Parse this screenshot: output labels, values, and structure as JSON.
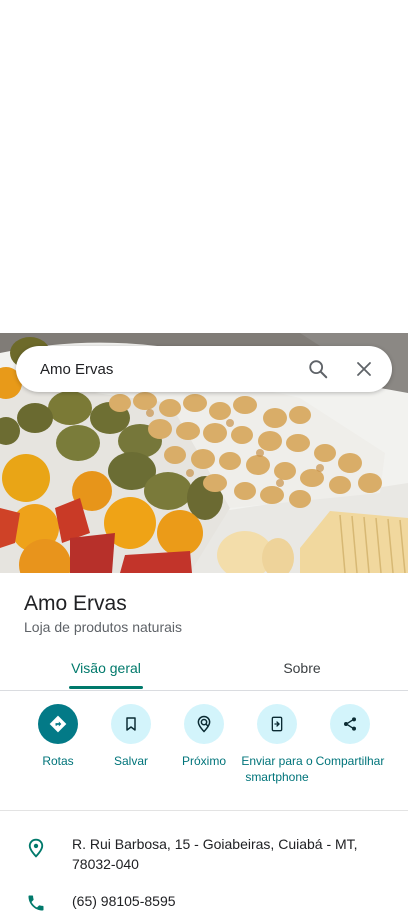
{
  "search": {
    "query": "Amo Ervas"
  },
  "place": {
    "name": "Amo Ervas",
    "category": "Loja de produtos naturais"
  },
  "tabs": [
    {
      "label": "Visão geral"
    },
    {
      "label": "Sobre"
    }
  ],
  "actions": [
    {
      "label": "Rotas",
      "icon": "directions-icon"
    },
    {
      "label": "Salvar",
      "icon": "bookmark-icon"
    },
    {
      "label": "Próximo",
      "icon": "nearby-icon"
    },
    {
      "label": "Enviar para o smartphone",
      "icon": "send-to-phone-icon"
    },
    {
      "label": "Compartilhar",
      "icon": "share-icon"
    }
  ],
  "info": {
    "address": "R. Rui Barbosa, 15 - Goiabeiras, Cuiabá - MT, 78032-040",
    "phone": "(65) 98105-8595"
  },
  "colors": {
    "accent": "#00796b",
    "action_bg": "#d3f4fb",
    "primary_action": "#037a87"
  }
}
